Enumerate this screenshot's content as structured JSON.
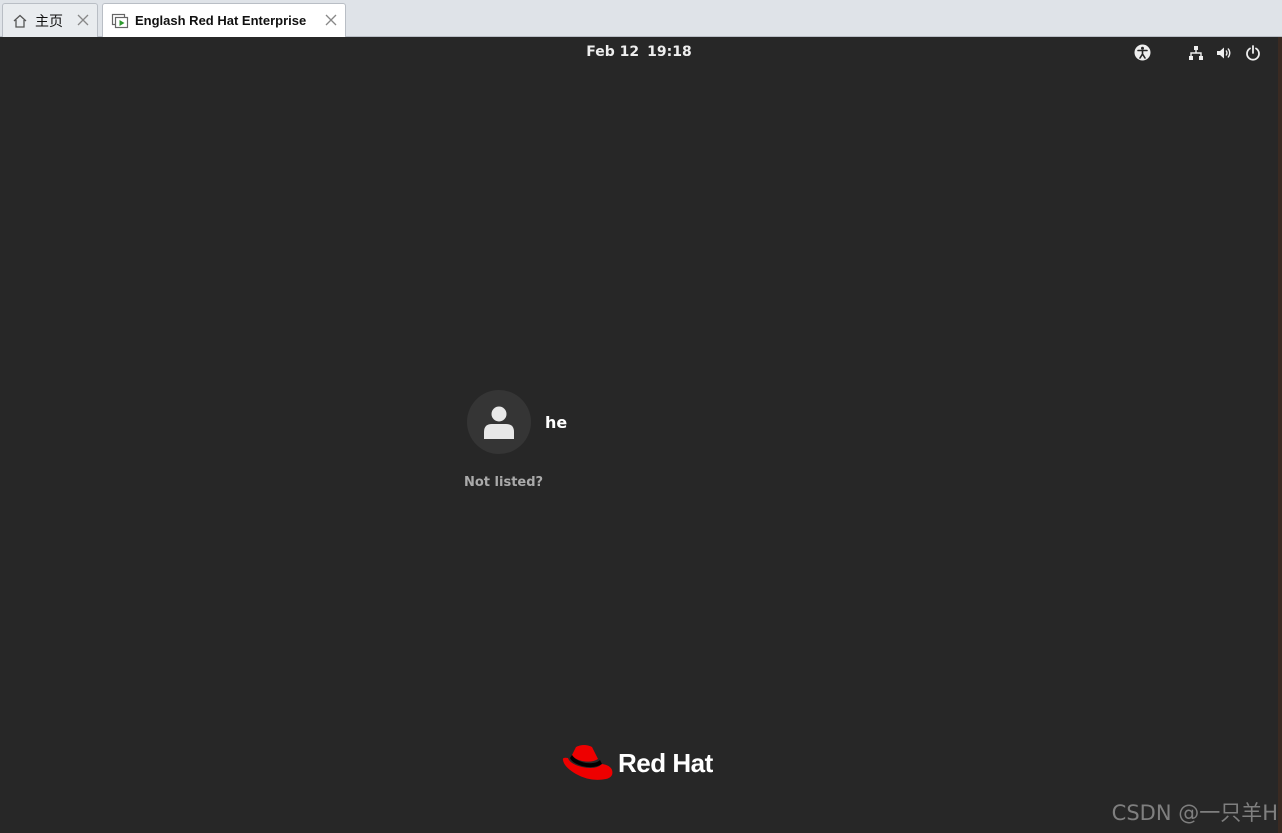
{
  "host": {
    "tabs": [
      {
        "label": "主页",
        "icon": "home-icon"
      },
      {
        "label": "Englash Red Hat Enterprise",
        "icon": "vm-icon"
      }
    ]
  },
  "topbar": {
    "date": "Feb 12",
    "time": "19:18",
    "icons": [
      "accessibility-icon",
      "network-icon",
      "volume-icon",
      "power-icon"
    ]
  },
  "login": {
    "username": "he",
    "not_listed": "Not listed?"
  },
  "logo": {
    "text": "Red Hat",
    "color": "#ee0000"
  },
  "watermark": "CSDN @一只羊H"
}
